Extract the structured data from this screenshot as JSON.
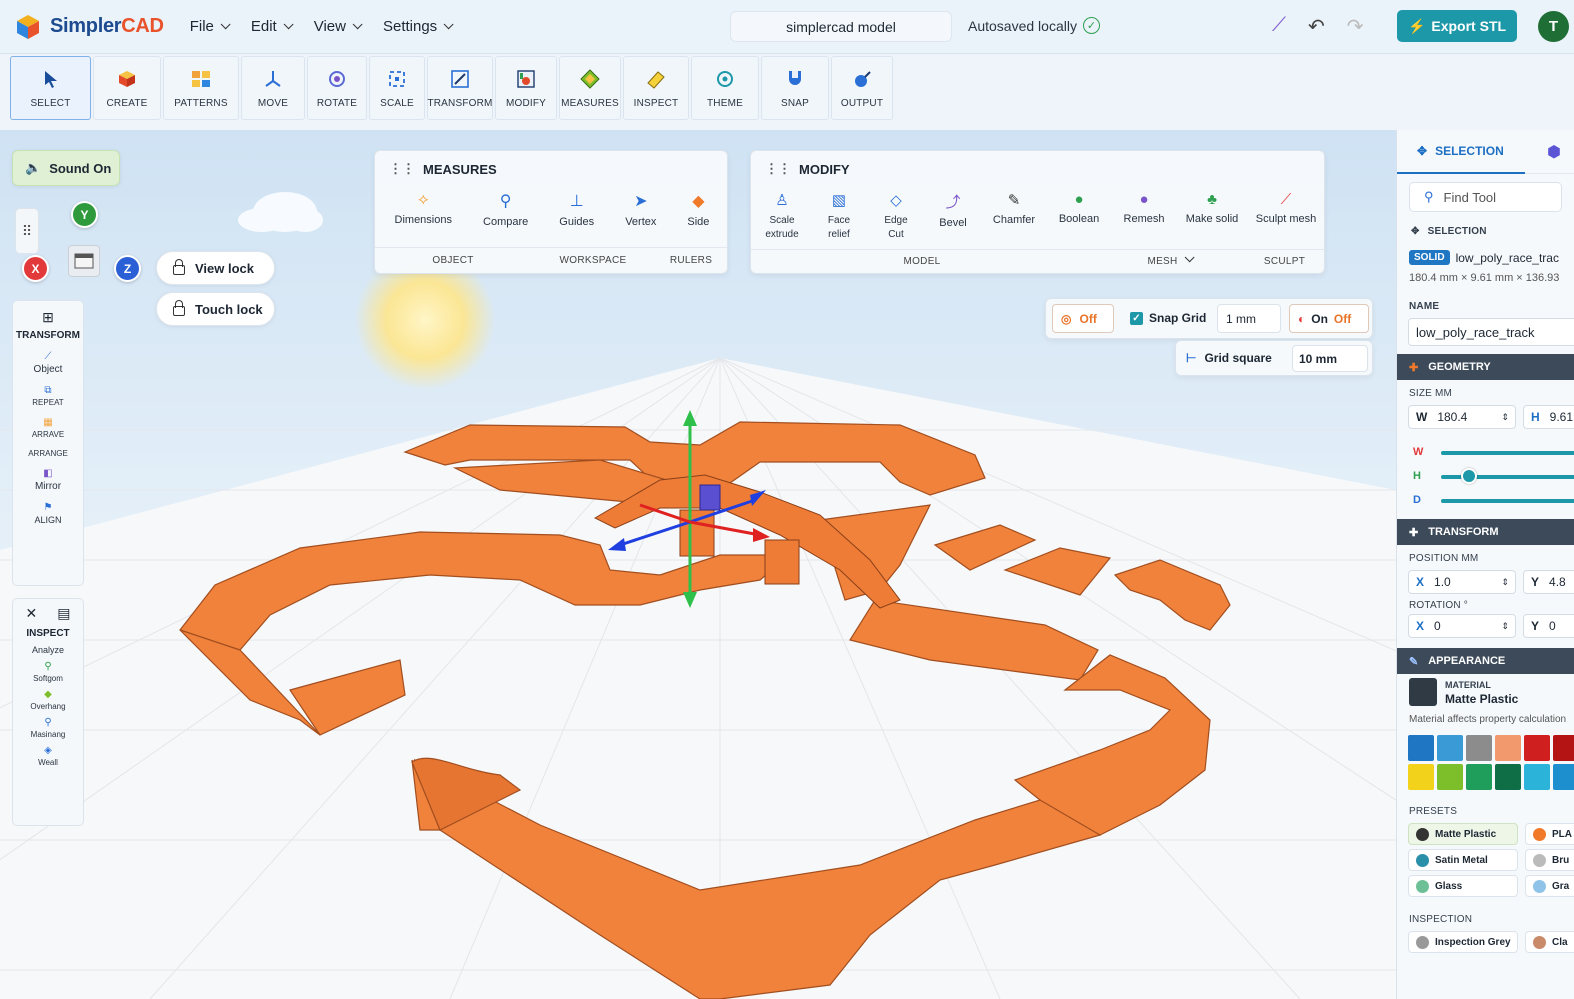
{
  "app": {
    "logo_name_part1": "Simpler",
    "logo_name_part2": "CAD",
    "model_name": "simplercad model",
    "autosave_status": "Autosaved locally",
    "export_label": "Export STL",
    "avatar_initial": "T"
  },
  "menu": [
    {
      "label": "File"
    },
    {
      "label": "Edit"
    },
    {
      "label": "View"
    },
    {
      "label": "Settings"
    }
  ],
  "toolbar": [
    {
      "label": "SELECT",
      "icon": "cursor-icon",
      "active": true
    },
    {
      "label": "CREATE",
      "icon": "cube-icon"
    },
    {
      "label": "PATTERNS",
      "icon": "patterns-icon"
    },
    {
      "label": "MOVE",
      "icon": "move-icon"
    },
    {
      "label": "ROTATE",
      "icon": "rotate-icon"
    },
    {
      "label": "SCALE",
      "icon": "scale-icon"
    },
    {
      "label": "TRANSFORM",
      "icon": "transform-icon"
    },
    {
      "label": "MODIFY",
      "icon": "modify-icon"
    },
    {
      "label": "MEASURES",
      "icon": "measures-icon"
    },
    {
      "label": "INSPECT",
      "icon": "inspect-icon"
    },
    {
      "label": "THEME",
      "icon": "theme-icon"
    },
    {
      "label": "SNAP",
      "icon": "snap-icon"
    },
    {
      "label": "OUTPUT",
      "icon": "output-icon"
    }
  ],
  "sound": {
    "label": "Sound On"
  },
  "locks": {
    "view": "View lock",
    "touch": "Touch lock"
  },
  "axes": {
    "x": "X",
    "y": "Y",
    "z": "Z"
  },
  "measures_panel": {
    "title": "MEASURES",
    "items": [
      "Dimensions",
      "Compare",
      "Guides",
      "Vertex",
      "Side"
    ],
    "sections": [
      "OBJECT",
      "WORKSPACE",
      "RULERS"
    ]
  },
  "modify_panel": {
    "title": "MODIFY",
    "items": [
      {
        "line1": "Scale",
        "line2": "extrude"
      },
      {
        "line1": "Face",
        "line2": "relief"
      },
      {
        "line1": "Edge",
        "line2": "Cut"
      },
      {
        "line1": "Bevel",
        "line2": ""
      },
      {
        "line1": "Chamfer",
        "line2": ""
      },
      {
        "line1": "Boolean",
        "line2": ""
      },
      {
        "line1": "Remesh",
        "line2": ""
      },
      {
        "line1": "Make solid",
        "line2": ""
      },
      {
        "line1": "Sculpt mesh",
        "line2": ""
      }
    ],
    "sections": [
      "MODEL",
      "MESH",
      "SCULPT"
    ]
  },
  "snap_bar": {
    "off_label": "Off",
    "snap_grid_label": "Snap Grid",
    "snap_grid_checked": true,
    "snap_value": "1 mm",
    "on_label": "On",
    "off2_label": "Off",
    "grid_square_label": "Grid square",
    "grid_square_value": "10 mm"
  },
  "left_transform": {
    "title": "TRANSFORM",
    "items": [
      "Object",
      "REPEAT",
      "ARRAVE",
      "ARRANGE",
      "Mirror",
      "ALIGN"
    ]
  },
  "left_inspect": {
    "title": "INSPECT",
    "items": [
      "Analyze",
      "Softgom",
      "Overhang",
      "Masinang",
      "Weall"
    ]
  },
  "right_panel": {
    "tab_selection": "SELECTION",
    "find_placeholder": "Find Tool",
    "selection_label": "SELECTION",
    "solid_badge": "SOLID",
    "object_name": "low_poly_race_trac",
    "dimensions": "180.4 mm × 9.61 mm × 136.93",
    "name_label": "NAME",
    "name_value": "low_poly_race_track",
    "geometry_label": "GEOMETRY",
    "size_label": "SIZE MM",
    "w_label": "W",
    "w_value": "180.4",
    "h_label": "H",
    "h_value": "9.61",
    "slider_w": "W",
    "slider_h": "H",
    "slider_d": "D",
    "transform_label": "TRANSFORM",
    "position_label": "POSITION MM",
    "pos_x_label": "X",
    "pos_x": "1.0",
    "pos_y_label": "Y",
    "pos_y": "4.8",
    "rotation_label": "ROTATION °",
    "rot_x_label": "X",
    "rot_x": "0",
    "rot_y_label": "Y",
    "rot_y": "0",
    "appearance_label": "APPEARANCE",
    "material_label": "MATERIAL",
    "material_value": "Matte Plastic",
    "material_note": "Material affects property calculation",
    "presets_label": "PRESETS",
    "presets": [
      "Matte Plastic",
      "PLA",
      "Satin Metal",
      "Bru",
      "Glass",
      "Gra"
    ],
    "inspection_label": "INSPECTION",
    "inspection": [
      "Inspection Grey",
      "Cla"
    ]
  },
  "colors": {
    "accent": "#1c98a8",
    "track": "#f0823c",
    "swatches": [
      "#1f77c4",
      "#3a9ad6",
      "#8c8c8c",
      "#f29a6e",
      "#cf1f1f",
      "#b51414",
      "#f2d21a",
      "#7cbf2a",
      "#1f9e5b",
      "#0f6e45",
      "#2bb3d9",
      "#1d8fcf"
    ]
  }
}
